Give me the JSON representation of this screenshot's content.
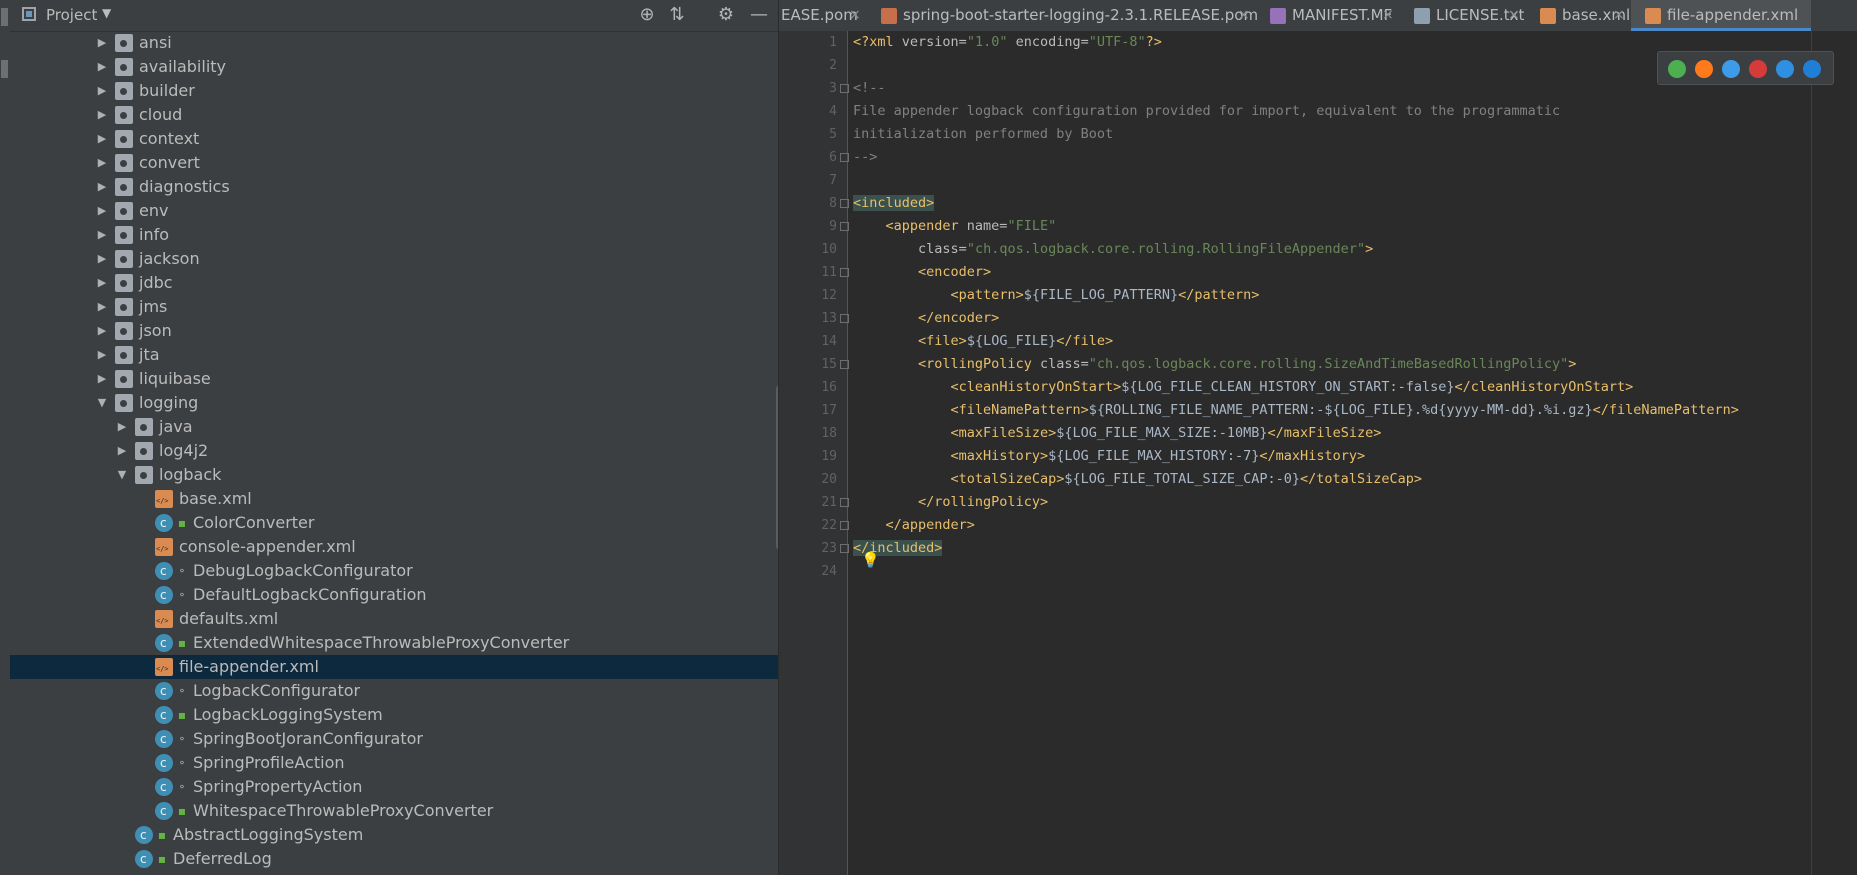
{
  "project_panel": {
    "title": "Project",
    "tree": [
      {
        "label": "ansi",
        "icon": "package-icon",
        "expanded": false,
        "depth": 0,
        "mod": ""
      },
      {
        "label": "availability",
        "icon": "package-icon",
        "expanded": false,
        "depth": 0,
        "mod": ""
      },
      {
        "label": "builder",
        "icon": "package-icon",
        "expanded": false,
        "depth": 0,
        "mod": ""
      },
      {
        "label": "cloud",
        "icon": "package-icon",
        "expanded": false,
        "depth": 0,
        "mod": ""
      },
      {
        "label": "context",
        "icon": "package-icon",
        "expanded": false,
        "depth": 0,
        "mod": ""
      },
      {
        "label": "convert",
        "icon": "package-icon",
        "expanded": false,
        "depth": 0,
        "mod": ""
      },
      {
        "label": "diagnostics",
        "icon": "package-icon",
        "expanded": false,
        "depth": 0,
        "mod": ""
      },
      {
        "label": "env",
        "icon": "package-icon",
        "expanded": false,
        "depth": 0,
        "mod": ""
      },
      {
        "label": "info",
        "icon": "package-icon",
        "expanded": false,
        "depth": 0,
        "mod": ""
      },
      {
        "label": "jackson",
        "icon": "package-icon",
        "expanded": false,
        "depth": 0,
        "mod": ""
      },
      {
        "label": "jdbc",
        "icon": "package-icon",
        "expanded": false,
        "depth": 0,
        "mod": ""
      },
      {
        "label": "jms",
        "icon": "package-icon",
        "expanded": false,
        "depth": 0,
        "mod": ""
      },
      {
        "label": "json",
        "icon": "package-icon",
        "expanded": false,
        "depth": 0,
        "mod": ""
      },
      {
        "label": "jta",
        "icon": "package-icon",
        "expanded": false,
        "depth": 0,
        "mod": ""
      },
      {
        "label": "liquibase",
        "icon": "package-icon",
        "expanded": false,
        "depth": 0,
        "mod": ""
      },
      {
        "label": "logging",
        "icon": "package-icon",
        "expanded": true,
        "depth": 0,
        "mod": ""
      },
      {
        "label": "java",
        "icon": "package-icon",
        "expanded": false,
        "depth": 1,
        "mod": ""
      },
      {
        "label": "log4j2",
        "icon": "package-icon",
        "expanded": false,
        "depth": 1,
        "mod": ""
      },
      {
        "label": "logback",
        "icon": "package-icon",
        "expanded": true,
        "depth": 1,
        "mod": ""
      },
      {
        "label": "base.xml",
        "icon": "xml-file-icon",
        "expanded": null,
        "depth": 2,
        "mod": ""
      },
      {
        "label": "ColorConverter",
        "icon": "class-icon",
        "expanded": null,
        "depth": 2,
        "mod": "lock"
      },
      {
        "label": "console-appender.xml",
        "icon": "xml-file-icon",
        "expanded": null,
        "depth": 2,
        "mod": ""
      },
      {
        "label": "DebugLogbackConfigurator",
        "icon": "class-icon",
        "expanded": null,
        "depth": 2,
        "mod": "pkgp"
      },
      {
        "label": "DefaultLogbackConfiguration",
        "icon": "class-icon",
        "expanded": null,
        "depth": 2,
        "mod": "pkgp"
      },
      {
        "label": "defaults.xml",
        "icon": "xml-file-icon",
        "expanded": null,
        "depth": 2,
        "mod": ""
      },
      {
        "label": "ExtendedWhitespaceThrowableProxyConverter",
        "icon": "class-icon",
        "expanded": null,
        "depth": 2,
        "mod": "lock"
      },
      {
        "label": "file-appender.xml",
        "icon": "xml-file-icon",
        "expanded": null,
        "depth": 2,
        "mod": "",
        "selected": true
      },
      {
        "label": "LogbackConfigurator",
        "icon": "class-icon",
        "expanded": null,
        "depth": 2,
        "mod": "pkgp"
      },
      {
        "label": "LogbackLoggingSystem",
        "icon": "class-icon",
        "expanded": null,
        "depth": 2,
        "mod": "lock"
      },
      {
        "label": "SpringBootJoranConfigurator",
        "icon": "class-icon",
        "expanded": null,
        "depth": 2,
        "mod": "pkgp"
      },
      {
        "label": "SpringProfileAction",
        "icon": "class-icon",
        "expanded": null,
        "depth": 2,
        "mod": "pkgp"
      },
      {
        "label": "SpringPropertyAction",
        "icon": "class-icon",
        "expanded": null,
        "depth": 2,
        "mod": "pkgp"
      },
      {
        "label": "WhitespaceThrowableProxyConverter",
        "icon": "class-icon",
        "expanded": null,
        "depth": 2,
        "mod": "lock"
      },
      {
        "label": "AbstractLoggingSystem",
        "icon": "abstract-class-icon",
        "expanded": null,
        "depth": 1,
        "mod": "lock"
      },
      {
        "label": "DeferredLog",
        "icon": "class-icon",
        "expanded": null,
        "depth": 1,
        "mod": "lock"
      }
    ]
  },
  "tabs": [
    {
      "label": "EASE.pom",
      "icon": "",
      "active": false
    },
    {
      "label": "spring-boot-starter-logging-2.3.1.RELEASE.pom",
      "icon": "pom",
      "active": false
    },
    {
      "label": "MANIFEST.MF",
      "icon": "mf",
      "active": false
    },
    {
      "label": "LICENSE.txt",
      "icon": "txt",
      "active": false
    },
    {
      "label": "base.xml",
      "icon": "xml",
      "active": false
    },
    {
      "label": "file-appender.xml",
      "icon": "xml",
      "active": true
    }
  ],
  "editor": {
    "lines": [
      [
        [
          "tag",
          "<?xml "
        ],
        [
          "attr",
          "version="
        ],
        [
          "val",
          "\"1.0\""
        ],
        [
          "attr",
          " encoding="
        ],
        [
          "val",
          "\"UTF-8\""
        ],
        [
          "tag",
          "?>"
        ]
      ],
      [],
      [
        [
          "cmt",
          "<!--"
        ]
      ],
      [
        [
          "cmt",
          "File appender logback configuration provided for import, equivalent to the programmatic"
        ]
      ],
      [
        [
          "cmt",
          "initialization performed by Boot"
        ]
      ],
      [
        [
          "cmt",
          "-->"
        ]
      ],
      [],
      [
        [
          "hltag",
          "<included>"
        ]
      ],
      [
        [
          "txt",
          "    "
        ],
        [
          "tag",
          "<appender "
        ],
        [
          "attr",
          "name="
        ],
        [
          "val",
          "\"FILE\""
        ]
      ],
      [
        [
          "txt",
          "        "
        ],
        [
          "attr",
          "class="
        ],
        [
          "val",
          "\"ch.qos.logback.core.rolling.RollingFileAppender\""
        ],
        [
          "tag",
          ">"
        ]
      ],
      [
        [
          "txt",
          "        "
        ],
        [
          "tag",
          "<encoder>"
        ]
      ],
      [
        [
          "txt",
          "            "
        ],
        [
          "tag",
          "<pattern>"
        ],
        [
          "txt",
          "${FILE_LOG_PATTERN}"
        ],
        [
          "tag",
          "</pattern>"
        ]
      ],
      [
        [
          "txt",
          "        "
        ],
        [
          "tag",
          "</encoder>"
        ]
      ],
      [
        [
          "txt",
          "        "
        ],
        [
          "tag",
          "<file>"
        ],
        [
          "txt",
          "${LOG_FILE}"
        ],
        [
          "tag",
          "</file>"
        ]
      ],
      [
        [
          "txt",
          "        "
        ],
        [
          "tag",
          "<rollingPolicy "
        ],
        [
          "attr",
          "class="
        ],
        [
          "val",
          "\"ch.qos.logback.core.rolling.SizeAndTimeBasedRollingPolicy\""
        ],
        [
          "tag",
          ">"
        ]
      ],
      [
        [
          "txt",
          "            "
        ],
        [
          "tag",
          "<cleanHistoryOnStart>"
        ],
        [
          "txt",
          "${LOG_FILE_CLEAN_HISTORY_ON_START:-false}"
        ],
        [
          "tag",
          "</cleanHistoryOnStart>"
        ]
      ],
      [
        [
          "txt",
          "            "
        ],
        [
          "tag",
          "<fileNamePattern>"
        ],
        [
          "txt",
          "${ROLLING_FILE_NAME_PATTERN:-${LOG_FILE}.%d{yyyy-MM-dd}.%i.gz}"
        ],
        [
          "tag",
          "</fileNamePattern>"
        ]
      ],
      [
        [
          "txt",
          "            "
        ],
        [
          "tag",
          "<maxFileSize>"
        ],
        [
          "txt",
          "${LOG_FILE_MAX_SIZE:-10MB}"
        ],
        [
          "tag",
          "</maxFileSize>"
        ]
      ],
      [
        [
          "txt",
          "            "
        ],
        [
          "tag",
          "<maxHistory>"
        ],
        [
          "txt",
          "${LOG_FILE_MAX_HISTORY:-7}"
        ],
        [
          "tag",
          "</maxHistory>"
        ]
      ],
      [
        [
          "txt",
          "            "
        ],
        [
          "tag",
          "<totalSizeCap>"
        ],
        [
          "txt",
          "${LOG_FILE_TOTAL_SIZE_CAP:-0}"
        ],
        [
          "tag",
          "</totalSizeCap>"
        ]
      ],
      [
        [
          "txt",
          "        "
        ],
        [
          "tag",
          "</rollingPolicy>"
        ]
      ],
      [
        [
          "txt",
          "    "
        ],
        [
          "tag",
          "</appender>"
        ]
      ],
      [
        [
          "hltag",
          "</included>"
        ]
      ],
      []
    ]
  },
  "colors": {
    "background": "#2b2b2b",
    "panel": "#3c3f41",
    "selection": "#0d293e",
    "tag": "#e8bf6a",
    "attr_value": "#6a8759",
    "comment": "#808080"
  },
  "browser_icons": [
    "chrome-icon",
    "firefox-icon",
    "safari-icon",
    "opera-icon",
    "internet-explorer-icon",
    "edge-icon"
  ]
}
